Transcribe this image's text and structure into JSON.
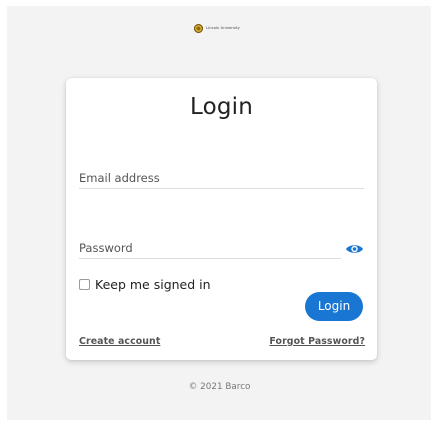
{
  "brand": {
    "name": "Lincoln University"
  },
  "form": {
    "title": "Login",
    "email_label": "Email address",
    "password_label": "Password",
    "keep_signed_in": "Keep me signed in",
    "submit_label": "Login"
  },
  "links": {
    "create_account": "Create account",
    "forgot_password": "Forgot Password?"
  },
  "footer": {
    "copyright": "© 2021 Barco"
  },
  "colors": {
    "accent": "#1976d2",
    "page_background": "#f3f3f3"
  }
}
